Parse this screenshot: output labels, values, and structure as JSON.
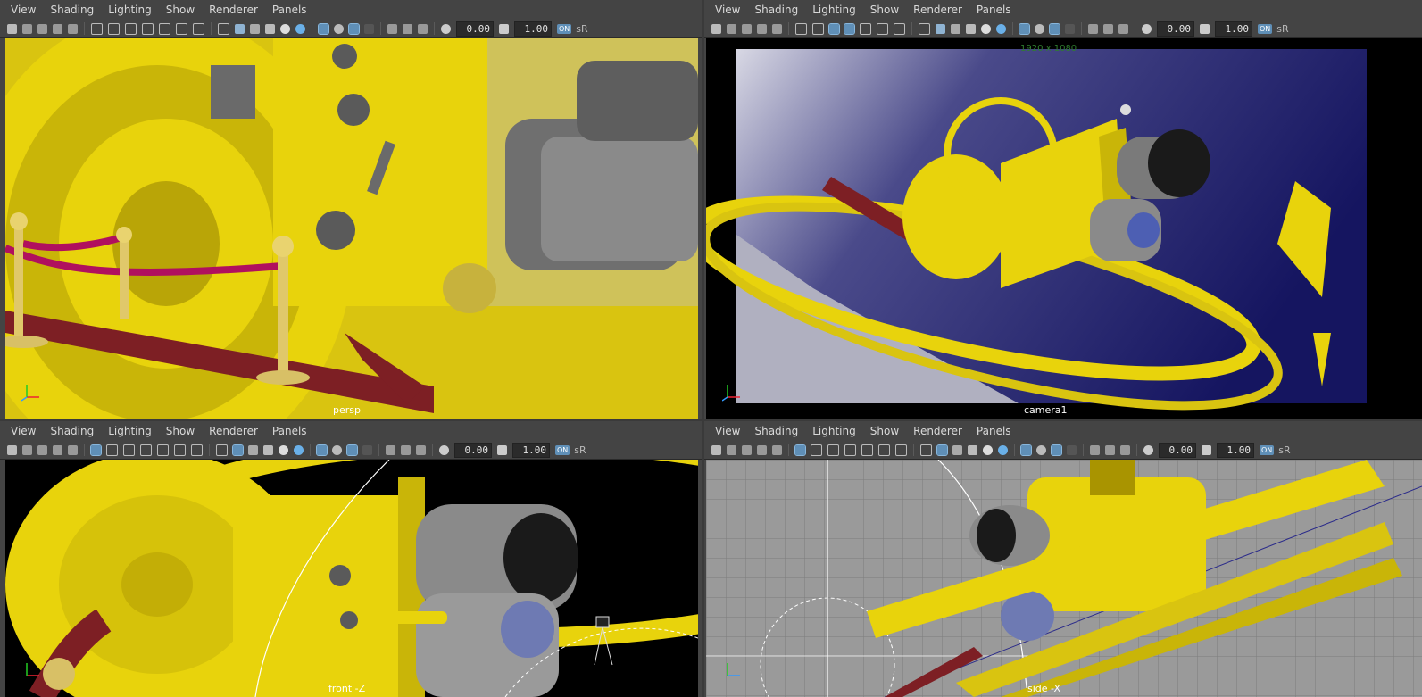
{
  "menus": [
    "View",
    "Shading",
    "Lighting",
    "Show",
    "Renderer",
    "Panels"
  ],
  "toolbar": {
    "field1": "0.00",
    "field2": "1.00",
    "badge": "ON",
    "color_space": "sR"
  },
  "panels": [
    {
      "id": "persp",
      "label": "persp"
    },
    {
      "id": "camera1",
      "label": "camera1",
      "resolution_gate": "1920 x 1080"
    },
    {
      "id": "front",
      "label": "front -Z"
    },
    {
      "id": "side",
      "label": "side -X"
    }
  ],
  "axis_labels": {
    "x": "x",
    "y": "y",
    "z": "z"
  },
  "colors": {
    "ui_bg": "#444444",
    "gold": "#e8d30c",
    "gold_dark": "#a99400",
    "red_carpet": "#7d1f24",
    "rope": "#b0105e",
    "sky": "#1c1c6e",
    "grid_bg": "#9a9a9a"
  }
}
